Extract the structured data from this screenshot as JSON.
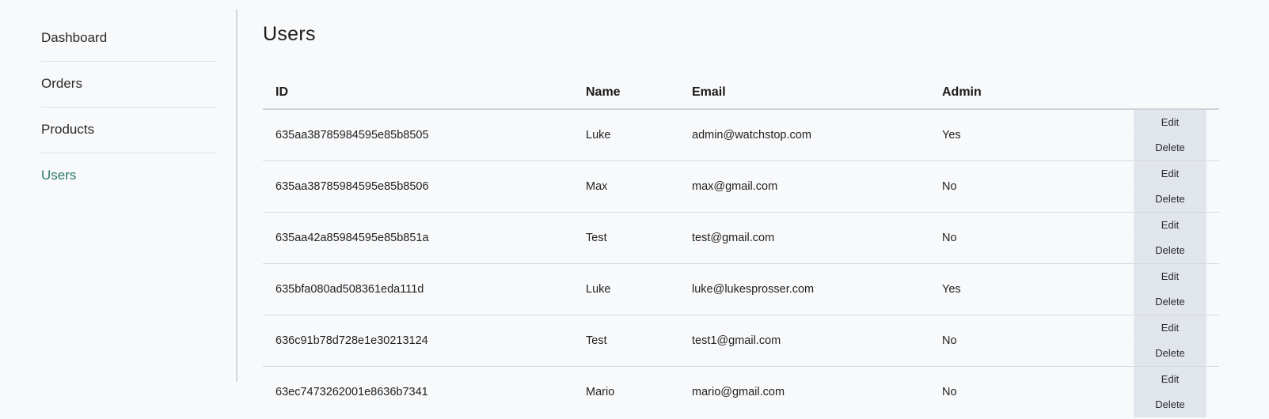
{
  "sidebar": {
    "items": [
      {
        "label": "Dashboard",
        "active": false
      },
      {
        "label": "Orders",
        "active": false
      },
      {
        "label": "Products",
        "active": false
      },
      {
        "label": "Users",
        "active": true
      }
    ]
  },
  "page": {
    "title": "Users"
  },
  "table": {
    "headers": [
      "ID",
      "Name",
      "Email",
      "Admin",
      ""
    ],
    "edit_label": "Edit",
    "delete_label": "Delete",
    "rows": [
      {
        "id": "635aa38785984595e85b8505",
        "name": "Luke",
        "email": "admin@watchstop.com",
        "admin": "Yes"
      },
      {
        "id": "635aa38785984595e85b8506",
        "name": "Max",
        "email": "max@gmail.com",
        "admin": "No"
      },
      {
        "id": "635aa42a85984595e85b851a",
        "name": "Test",
        "email": "test@gmail.com",
        "admin": "No"
      },
      {
        "id": "635bfa080ad508361eda111d",
        "name": "Luke",
        "email": "luke@lukesprosser.com",
        "admin": "Yes"
      },
      {
        "id": "636c91b78d728e1e30213124",
        "name": "Test",
        "email": "test1@gmail.com",
        "admin": "No"
      },
      {
        "id": "63ec7473262001e8636b7341",
        "name": "Mario",
        "email": "mario@gmail.com",
        "admin": "No"
      }
    ]
  },
  "colors": {
    "background": "#f8f9fb",
    "active_link": "#2c7a69",
    "button_bg": "#e1e5ec"
  }
}
